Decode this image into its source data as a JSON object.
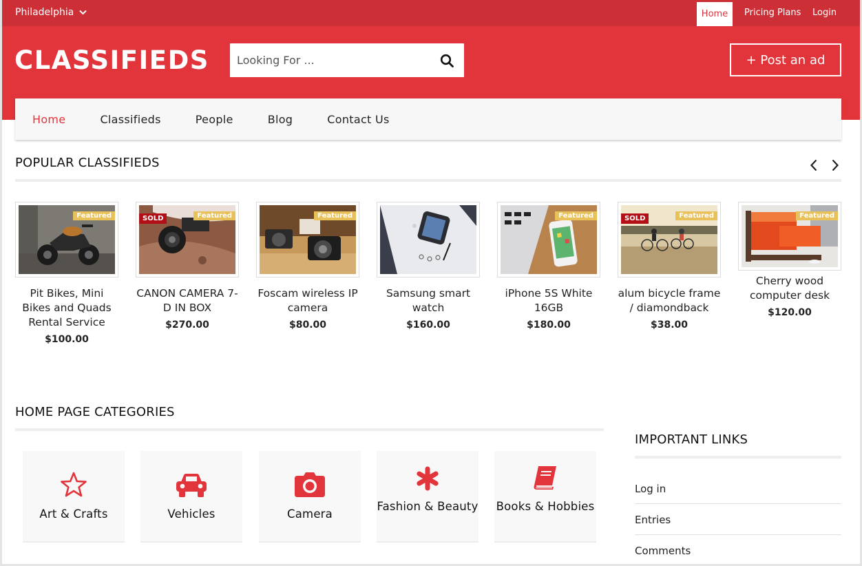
{
  "topbar": {
    "city": "Philadelphia",
    "home": "Home",
    "pricing": "Pricing Plans",
    "login": "Login"
  },
  "header": {
    "logo": "CLASSIFIEDS",
    "search_placeholder": "Looking For ...",
    "post_ad": "+ Post an ad"
  },
  "nav": [
    "Home",
    "Classifieds",
    "People",
    "Blog",
    "Contact Us"
  ],
  "popular": {
    "title": "POPULAR CLASSIFIEDS",
    "items": [
      {
        "name": "Pit Bikes, Mini Bikes and Quads Rental Service",
        "price": "$100.00",
        "featured": "Featured",
        "sold": ""
      },
      {
        "name": "CANON CAMERA 7-D IN BOX",
        "price": "$270.00",
        "featured": "Featured",
        "sold": "SOLD"
      },
      {
        "name": "Foscam wireless IP camera",
        "price": "$80.00",
        "featured": "Featured",
        "sold": ""
      },
      {
        "name": "Samsung smart watch",
        "price": "$160.00",
        "featured": "",
        "sold": ""
      },
      {
        "name": "iPhone 5S White 16GB",
        "price": "$180.00",
        "featured": "Featured",
        "sold": ""
      },
      {
        "name": "alum bicycle frame / diamondback",
        "price": "$38.00",
        "featured": "Featured",
        "sold": "SOLD"
      },
      {
        "name": "Cherry wood computer desk",
        "price": "$120.00",
        "featured": "Featured",
        "sold": ""
      }
    ]
  },
  "categories": {
    "title": "HOME PAGE CATEGORIES",
    "items": [
      {
        "label": "Art & Crafts",
        "icon": "star-icon"
      },
      {
        "label": "Vehicles",
        "icon": "car-icon"
      },
      {
        "label": "Camera",
        "icon": "camera-icon"
      },
      {
        "label": "Fashion & Beauty",
        "icon": "asterisk-icon"
      },
      {
        "label": "Books & Hobbies",
        "icon": "book-icon"
      }
    ]
  },
  "important": {
    "title": "IMPORTANT LINKS",
    "links": [
      "Log in",
      "Entries",
      "Comments"
    ]
  },
  "colors": {
    "brand_red": "#e1353b",
    "topbar_red": "#cc2f36",
    "featured": "#e9c15a",
    "sold": "#b30f17"
  }
}
